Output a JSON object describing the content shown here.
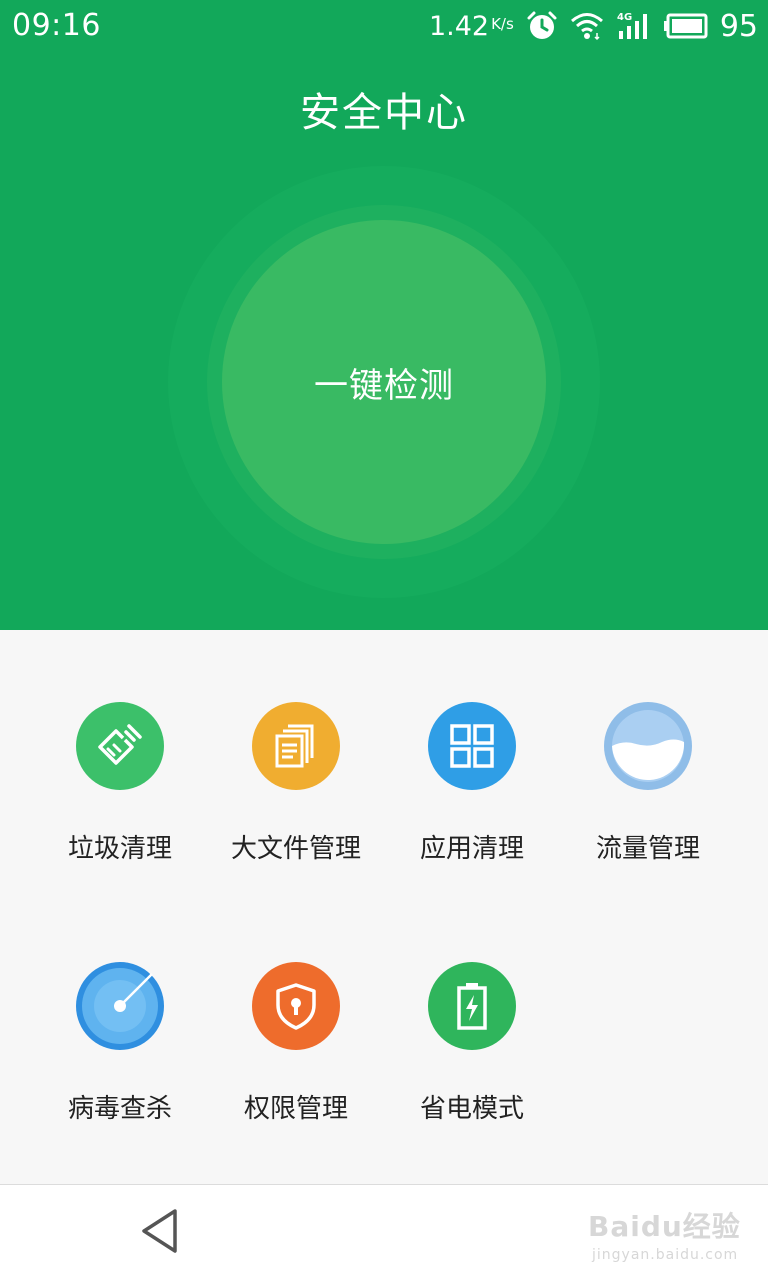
{
  "status_bar": {
    "time": "09:16",
    "network_speed": "1.42",
    "network_unit": "K/s",
    "network_type": "4G",
    "battery": "95",
    "icons": [
      "alarm-icon",
      "wifi-icon",
      "signal-icon",
      "battery-icon"
    ]
  },
  "header": {
    "title": "安全中心",
    "scan_button": "一键检测",
    "background_color": "#12a85a"
  },
  "tools": [
    {
      "label": "垃圾清理",
      "icon": "broom-icon",
      "color": "#3cc06a"
    },
    {
      "label": "大文件管理",
      "icon": "file-stack-icon",
      "color": "#f0ad30"
    },
    {
      "label": "应用清理",
      "icon": "app-grid-icon",
      "color": "#2f9ee6"
    },
    {
      "label": "流量管理",
      "icon": "data-usage-icon",
      "color": "#8fbde8"
    },
    {
      "label": "病毒查杀",
      "icon": "radar-icon",
      "color": "#2f8fe0"
    },
    {
      "label": "权限管理",
      "icon": "shield-lock-icon",
      "color": "#ee6c2c"
    },
    {
      "label": "省电模式",
      "icon": "battery-saver-icon",
      "color": "#2fb55c"
    }
  ],
  "nav_bar": {
    "back_icon": "back-triangle-icon",
    "watermark_main": "Baidu经验",
    "watermark_sub": "jingyan.baidu.com"
  }
}
